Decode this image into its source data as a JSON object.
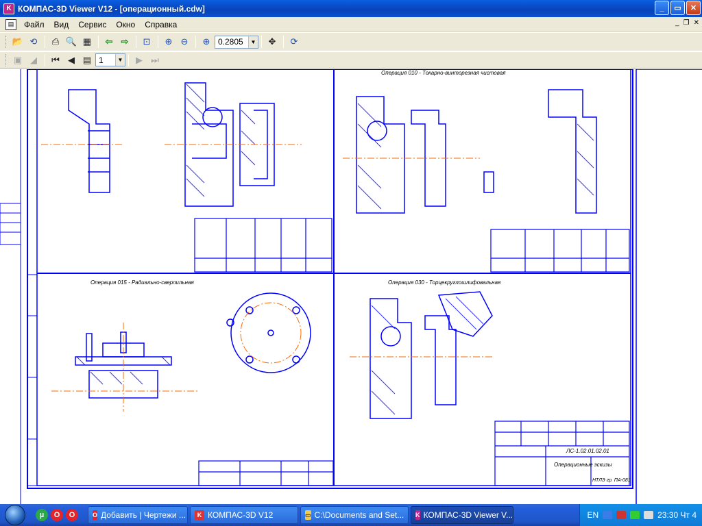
{
  "window": {
    "title": "КОМПАС-3D Viewer V12 - [операционный.cdw]",
    "app_icon": "K",
    "btn_min": "_",
    "btn_max": "▭",
    "btn_close": "✕"
  },
  "menu": {
    "items": [
      "Файл",
      "Вид",
      "Сервис",
      "Окно",
      "Справка"
    ],
    "mdi_min": "_",
    "mdi_restore": "❐",
    "mdi_close": "✕"
  },
  "toolbar": {
    "zoom_value": "0.2805",
    "page_value": "1"
  },
  "drawing": {
    "op_010_title": "Операция 010 - Токарно-винторезная чистовая",
    "op_015_title": "Операция 015 - Радиально-сверлильная",
    "op_030_title": "Операция 030 - Торцекруглошлифовальная",
    "stamp_title": "Операционные эскизы",
    "stamp_code": "ЛС-1.02.01.02.01",
    "stamp_group": "НТЛЭ гр. ПА-081",
    "accent_color": "#0000ff",
    "axis_color": "#ff6a00"
  },
  "taskbar": {
    "tasks": [
      "Добавить | Чертежи ...",
      "КОМПАС-3D V12",
      "C:\\Documents and Set...",
      "КОМПАС-3D Viewer V..."
    ],
    "lang": "EN",
    "clock": "23:30 Чт 4"
  }
}
